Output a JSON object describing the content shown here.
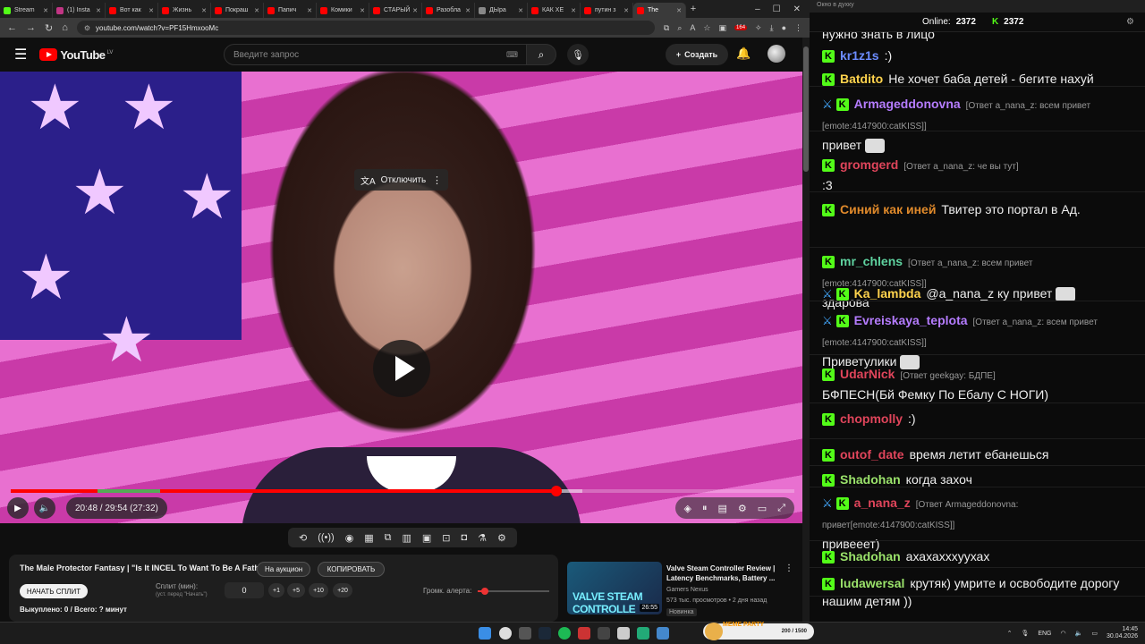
{
  "browser": {
    "tabs": [
      {
        "label": "Stream",
        "color": "#53fc18"
      },
      {
        "label": "(1) Insta",
        "color": "#c13584"
      },
      {
        "label": "Вот как",
        "color": "#ff0000"
      },
      {
        "label": "Жизнь",
        "color": "#ff0000"
      },
      {
        "label": "Покраш",
        "color": "#ff0000"
      },
      {
        "label": "Папич",
        "color": "#ff0000"
      },
      {
        "label": "Комики",
        "color": "#ff0000"
      },
      {
        "label": "СТАРЫЙ",
        "color": "#ff0000"
      },
      {
        "label": "Разобла",
        "color": "#ff0000"
      },
      {
        "label": "ДЫра",
        "color": "#888888"
      },
      {
        "label": "КАК ХЕ",
        "color": "#ff0000"
      },
      {
        "label": "путин з",
        "color": "#ff0000"
      },
      {
        "label": "The",
        "color": "#ff0000"
      }
    ],
    "url": "youtube.com/watch?v=PF15HmxooMc",
    "extension_badge": "164"
  },
  "youtube": {
    "logo_text": "YouTube",
    "country": "LV",
    "search_placeholder": "Введите запрос",
    "create_label": "Создать"
  },
  "player": {
    "unmute_label": "Отключить",
    "time_display": "20:48 / 29:54 (27:32)",
    "progress_fraction": 0.696,
    "buffered_fraction": 0.73
  },
  "info": {
    "video_title": "The Male Protector Fantasy | \"Is It INCEL To Want To Be A Father?\"",
    "auction_label": "На аукцион",
    "copy_label": "КОПИРОВАТЬ",
    "start_split_label": "НАЧАТЬ СПЛИТ",
    "split_label": "Сплит (мин):",
    "split_hint": "(уст. перед \"Начать\")",
    "split_value": "0",
    "increments": [
      "+1",
      "+5",
      "+10",
      "+20"
    ],
    "alert_volume_label": "Громк. алерта:",
    "alert_volume_fraction": 0.1,
    "bought_label": "Выкуплено: 0 / Всего: ? минут"
  },
  "recommendation": {
    "title": "Valve Steam Controller Review | Latency Benchmarks, Battery ...",
    "channel": "Gamers Nexus",
    "meta": "573 тыс. просмотров • 2 дня назад",
    "badge": "Новинка",
    "duration": "26:55",
    "thumb_text": "VALVE STEAM CONTROLLE"
  },
  "chat": {
    "window_title": "Окно в духку",
    "online_label": "Online:",
    "online_count": "2372",
    "kick_count": "2372",
    "messages": [
      {
        "user": "",
        "color": "#ffffff",
        "text": "нужно знать в лицо",
        "reply": "",
        "second": ""
      },
      {
        "user": "kr1z1s",
        "color": "#6c8cff",
        "text": ":)",
        "reply": "",
        "second": ""
      },
      {
        "user": "Batdito",
        "color": "#ffd34d",
        "text": "Не хочет баба детей - бегите нахуй",
        "reply": "",
        "second": ""
      },
      {
        "user": "Armageddonovna",
        "color": "#b57cff",
        "text": "",
        "reply": "[Ответ a_nana_z: всем привет [emote:4147900:catKISS]]",
        "second": "привет"
      },
      {
        "user": "gromgerd",
        "color": "#e0455b",
        "text": "",
        "reply": "[Ответ a_nana_z: че вы тут]",
        "second": ":3"
      },
      {
        "user": "Синий как иней",
        "color": "#e08a2b",
        "text": "Твитер это портал в Ад.",
        "reply": "",
        "second": ""
      },
      {
        "user": "mr_chlens",
        "color": "#5fd3a0",
        "text": "",
        "reply": "[Ответ a_nana_z: всем привет [emote:4147900:catKISS]]",
        "second": "здарова"
      },
      {
        "user": "Ka_lambda",
        "color": "#ffd34d",
        "text": "@a_nana_z ку привет",
        "reply": "",
        "second": ""
      },
      {
        "user": "Evreiskaya_teplota",
        "color": "#b57cff",
        "text": "",
        "reply": "[Ответ a_nana_z: всем привет [emote:4147900:catKISS]]",
        "second": "Приветулики"
      },
      {
        "user": "UdarNick",
        "color": "#e0455b",
        "text": "",
        "reply": "[Ответ geekgay: БДПЕ]",
        "second": "БФПЕСН(Бй Фемку По Ебалу С НОГИ)"
      },
      {
        "user": "chopmolly",
        "color": "#e0455b",
        "text": ":)",
        "reply": "",
        "second": ""
      },
      {
        "user": "outof_date",
        "color": "#e0455b",
        "text": "время летит ебанешься",
        "reply": "",
        "second": ""
      },
      {
        "user": "Shadohan",
        "color": "#9be36b",
        "text": "когда захоч",
        "reply": "",
        "second": ""
      },
      {
        "user": "a_nana_z",
        "color": "#e0455b",
        "text": "",
        "reply": "[Ответ Armageddonovna: привет[emote:4147900:catKISS]]",
        "second": "привееет)"
      },
      {
        "user": "Shadohan",
        "color": "#9be36b",
        "text": "ахахахххуухах",
        "reply": "",
        "second": ""
      },
      {
        "user": "ludawersal",
        "color": "#9be36b",
        "text": "крутяк) умрите и освободите дорогу нашим детям ))",
        "reply": "",
        "second": ""
      }
    ]
  },
  "taskbar": {
    "lang": "ENG",
    "time": "14:45",
    "date": "30.04.2026",
    "meme_party_label": "MEME PARTY",
    "meme_party_count": "200 / 1500"
  }
}
